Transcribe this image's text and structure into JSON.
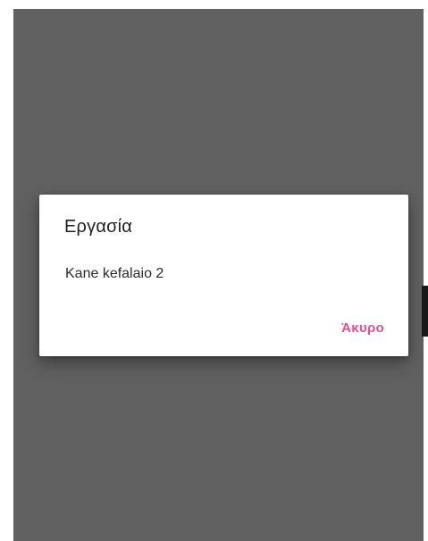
{
  "dialog": {
    "title": "Εργασία",
    "message": "Kane kefalaio 2",
    "cancel_label": "Άκυρο"
  },
  "colors": {
    "scrim": "#616161",
    "dialog_background": "#ffffff",
    "accent": "#e0508f"
  }
}
